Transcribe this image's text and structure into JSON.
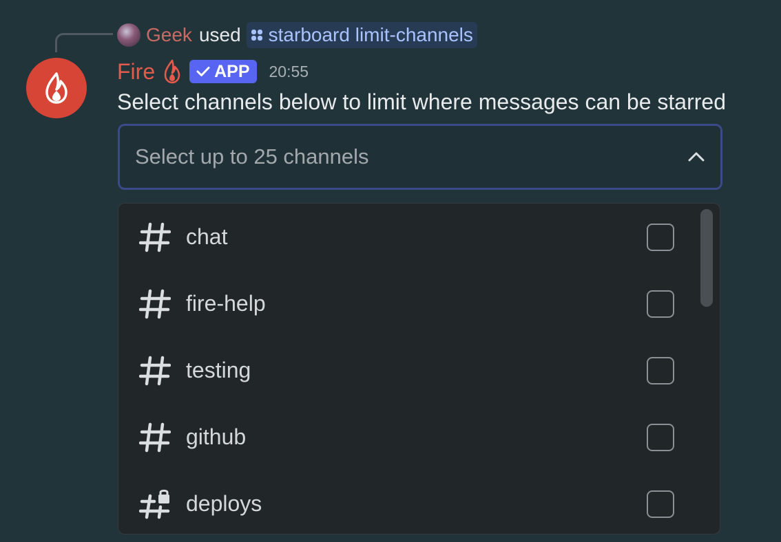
{
  "reply": {
    "username": "Geek",
    "action": "used",
    "command": "starboard limit-channels"
  },
  "message": {
    "author": "Fire",
    "badge": "APP",
    "timestamp": "20:55",
    "content": "Select channels below to limit where messages can be starred"
  },
  "select": {
    "placeholder": "Select up to 25 channels",
    "expanded": true,
    "options": [
      {
        "label": "chat",
        "icon": "text-channel-icon",
        "checked": false
      },
      {
        "label": "fire-help",
        "icon": "text-channel-icon",
        "checked": false
      },
      {
        "label": "testing",
        "icon": "text-channel-icon",
        "checked": false
      },
      {
        "label": "github",
        "icon": "text-channel-icon",
        "checked": false
      },
      {
        "label": "deploys",
        "icon": "locked-channel-icon",
        "checked": false
      }
    ]
  },
  "colors": {
    "background": "#20343a",
    "accent": "#5865f2",
    "author": "#e45b4c",
    "reply_user": "#c86a63",
    "command": "#a9c3ff"
  }
}
